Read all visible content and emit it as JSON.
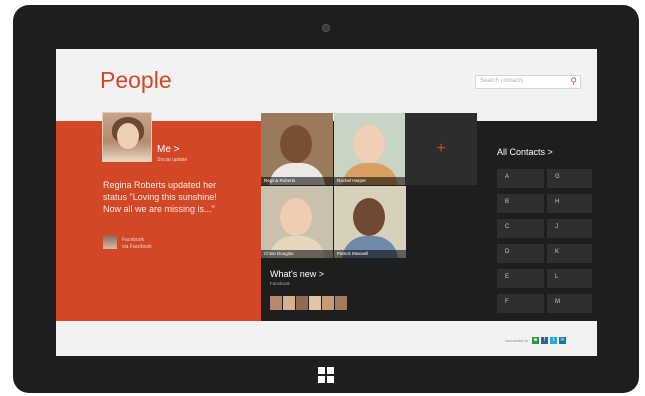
{
  "app": {
    "title": "People"
  },
  "search": {
    "placeholder": "Search contacts"
  },
  "me": {
    "label": "Me >",
    "sub": "Social update",
    "status": "Regina Roberts updated her status \"Loving this sunshine! Now all we are missing is...\"",
    "source_line1": "Facebook",
    "source_line2": "via Facebook"
  },
  "people": [
    {
      "name": "Regina Roberts",
      "bg": "#9b7a5c",
      "skin": "#7a4e31",
      "shirt": "#ece8e3"
    },
    {
      "name": "Rachel Harper",
      "bg": "#c8d4c4",
      "skin": "#f0cfb6",
      "shirt": "#d8a062"
    },
    {
      "name": "Chloe Douglas",
      "bg": "#c9c1ad",
      "skin": "#efcdb2",
      "shirt": "#e6d7bc"
    },
    {
      "name": "Patrick Maxwell",
      "bg": "#d7d0bb",
      "skin": "#6f4934",
      "shirt": "#6f8aa8"
    }
  ],
  "add_tile": {
    "symbol": "+"
  },
  "whats_new": {
    "title": "What's new >",
    "sub": "Facebook"
  },
  "thumbs": [
    "#b58a6c",
    "#d6b090",
    "#8f6b52",
    "#e2c4a6",
    "#c79a78",
    "#a37a5e"
  ],
  "contacts": {
    "title": "All Contacts >",
    "letters": [
      "A",
      "G",
      "B",
      "H",
      "C",
      "J",
      "D",
      "K",
      "E",
      "L",
      "F",
      "M"
    ]
  },
  "social": {
    "label": "connected to",
    "services": [
      {
        "name": "windows-live",
        "glyph": "■",
        "color": "#2a9a3e"
      },
      {
        "name": "facebook",
        "glyph": "f",
        "color": "#3b5998"
      },
      {
        "name": "twitter",
        "glyph": "t",
        "color": "#29a7df"
      },
      {
        "name": "linkedin",
        "glyph": "in",
        "color": "#0e76a8"
      }
    ]
  },
  "colors": {
    "accent": "#d24726",
    "dark": "#1e1e1e"
  }
}
